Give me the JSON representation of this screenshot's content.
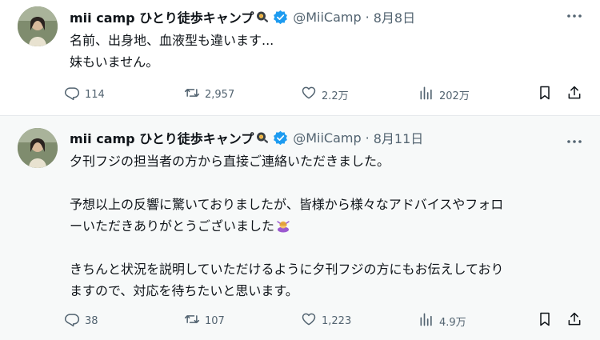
{
  "tweets": [
    {
      "display_name": "mii camp ひとり徒歩キャンプ",
      "handle": "@MiiCamp",
      "separator": "·",
      "date": "8月8日",
      "lines": [
        "名前、出身地、血液型も違います...",
        "妹もいません。"
      ],
      "stats": {
        "replies": "114",
        "retweets": "2,957",
        "likes": "2.2万",
        "views": "202万"
      }
    },
    {
      "display_name": "mii camp ひとり徒歩キャンプ",
      "handle": "@MiiCamp",
      "separator": "·",
      "date": "8月11日",
      "lines": [
        "夕刊フジの担当者の方から直接ご連絡いただきました。",
        "",
        "予想以上の反響に驚いておりましたが、皆様から様々なアドバイスやフォロ",
        "ーいただきありがとうございました",
        "",
        "きちんと状況を説明していただけるように夕刊フジの方にもお伝えしており",
        "ますので、対応を待ちたいと思います。"
      ],
      "stats": {
        "replies": "38",
        "retweets": "107",
        "likes": "1,223",
        "views": "4.9万"
      }
    }
  ],
  "icons": {
    "verified": "verified-badge-icon",
    "frying_pan": "frying-pan-icon",
    "bowing": "bowing-person-emoji",
    "more": "more-icon",
    "reply": "reply-icon",
    "retweet": "retweet-icon",
    "like": "heart-icon",
    "views": "views-icon",
    "bookmark": "bookmark-icon",
    "share": "share-icon"
  },
  "colors": {
    "verified": "#1d9bf0",
    "muted": "#536471",
    "text": "#0f1419",
    "highlight_bg": "#f7f9f9"
  }
}
